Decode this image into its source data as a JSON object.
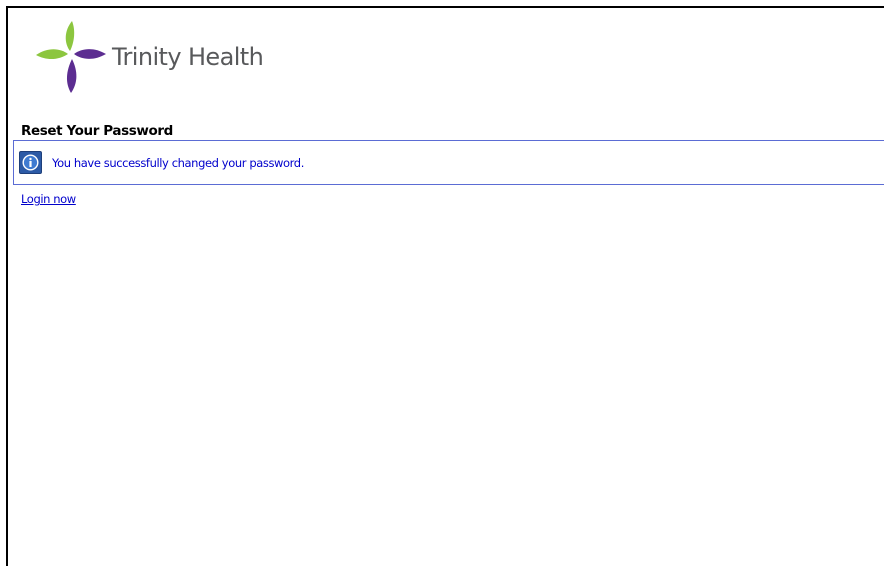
{
  "brand": {
    "name": "Trinity Health",
    "colors": {
      "green": "#8cc63f",
      "purple": "#5c2d91",
      "text": "#58595b"
    }
  },
  "page": {
    "title": "Reset Your Password"
  },
  "message": {
    "icon": "info-icon",
    "text": "You have successfully changed your password.",
    "color": "#0000cc",
    "border_color": "#5b6cd4"
  },
  "actions": {
    "login_label": "Login now"
  }
}
